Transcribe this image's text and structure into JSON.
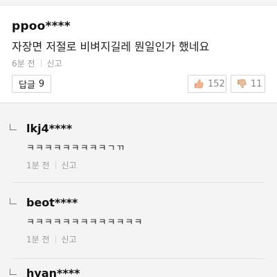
{
  "comment": {
    "author": "ppoo****",
    "body": "자장면 저절로 비벼지길레 뭔일인가 했네요",
    "time": "6분 전",
    "report": "신고",
    "reply_label": "답글",
    "reply_count": "9",
    "likes": "152",
    "dislikes": "11"
  },
  "replies": [
    {
      "author": "lkj4****",
      "body": "ㅋㅋㅋㅋㅋㅋㅋㅋㅋㄱㄲ",
      "time": "1분 전",
      "report": "신고"
    },
    {
      "author": "beot****",
      "body": "ㅋㅋㅋㅋㅋㅋㅋㅋㅋㅋㅋㅋㅋ",
      "time": "1분 전",
      "report": "신고"
    },
    {
      "author": "hyan****"
    }
  ],
  "colors": {
    "background": "#ffffff",
    "reply_background": "#f4f4f4",
    "muted_text": "#9a9a9a",
    "border": "#d5d5d5"
  },
  "icons": {
    "like": "thumbs-up-icon",
    "dislike": "thumbs-down-icon",
    "reply_corner": "reply-arrow-icon"
  }
}
